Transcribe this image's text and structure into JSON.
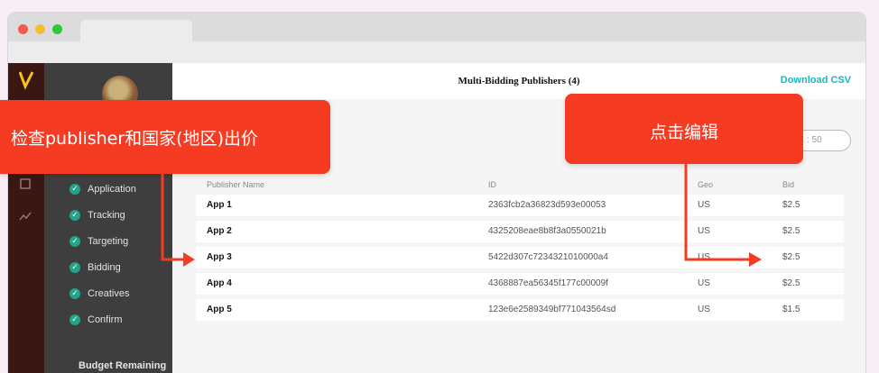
{
  "sidebar": {
    "steps": [
      "Application",
      "Tracking",
      "Targeting",
      "Bidding",
      "Creatives",
      "Confirm"
    ],
    "budget_label": "Budget Remaining"
  },
  "modal": {
    "title": "Multi-Bidding Publishers (4)",
    "download_label": "Download CSV",
    "page_size_label": ": 50",
    "columns": [
      "Publisher Name",
      "ID",
      "Geo",
      "Bid"
    ],
    "rows": [
      {
        "name": "App 1",
        "id": "2363fcb2a36823d593e00053",
        "geo": "US",
        "bid": "$2.5"
      },
      {
        "name": "App 2",
        "id": "4325208eae8b8f3a0550021b",
        "geo": "US",
        "bid": "$2.5"
      },
      {
        "name": "App 3",
        "id": "5422d307c7234321010000a4",
        "geo": "US",
        "bid": "$2.5"
      },
      {
        "name": "App 4",
        "id": "4368887ea56345f177c00009f",
        "geo": "US",
        "bid": "$2.5"
      },
      {
        "name": "App 5",
        "id": "123e6e2589349bf771043564sd",
        "geo": "US",
        "bid": "$1.5"
      }
    ]
  },
  "callouts": {
    "left": "检查publisher和国家(地区)出价",
    "right": "点击编辑"
  },
  "colors": {
    "accent": "#17b8c0",
    "callout": "#f53b22",
    "check": "#22a38a"
  }
}
